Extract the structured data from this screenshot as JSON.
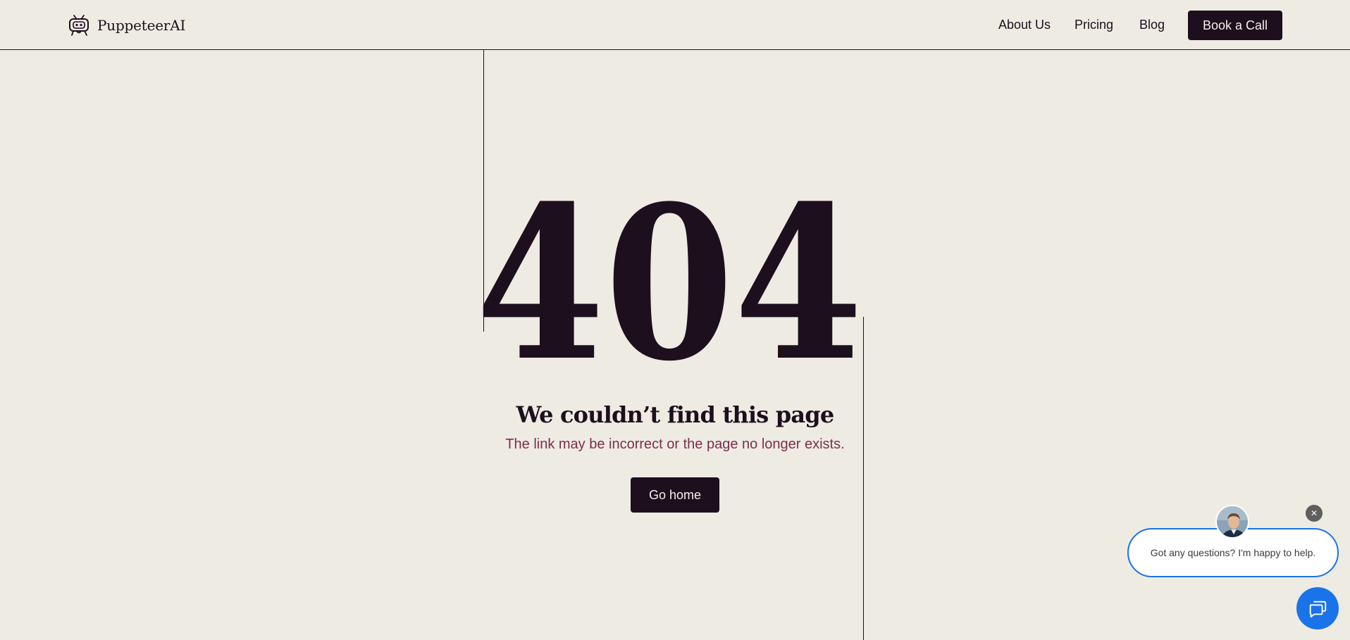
{
  "header": {
    "brand": "PuppeteerAI",
    "nav": [
      {
        "label": "About Us"
      },
      {
        "label": "Pricing"
      },
      {
        "label": "Blog"
      }
    ],
    "cta_label": "Book a Call"
  },
  "error": {
    "code": "404",
    "title": "We couldn’t find this page",
    "message": "The link may be incorrect or the page no longer exists.",
    "home_label": "Go home"
  },
  "chat": {
    "prompt": "Got any questions? I'm happy to help.",
    "close_glyph": "✕"
  },
  "colors": {
    "background": "#eeebe3",
    "ink": "#1d0f1e",
    "accent_text": "#7a2f4f",
    "chat_blue": "#1a73e8"
  }
}
